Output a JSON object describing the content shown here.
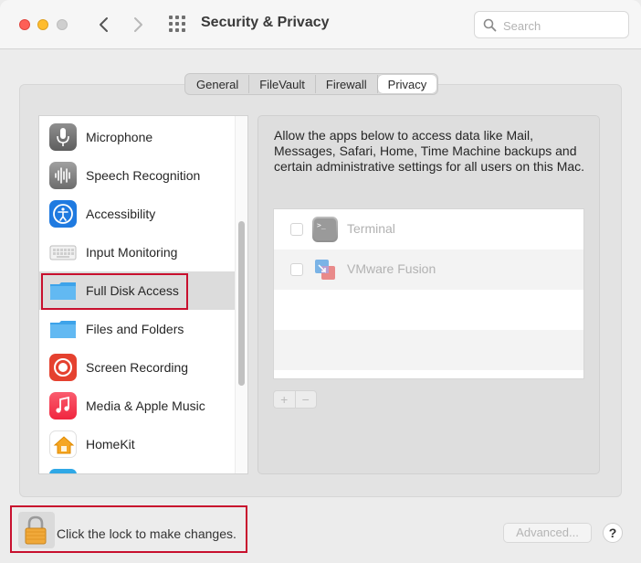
{
  "window": {
    "title": "Security & Privacy"
  },
  "search": {
    "placeholder": "Search",
    "value": ""
  },
  "tabs": [
    {
      "label": "General",
      "active": false
    },
    {
      "label": "FileVault",
      "active": false
    },
    {
      "label": "Firewall",
      "active": false
    },
    {
      "label": "Privacy",
      "active": true
    }
  ],
  "sidebar": {
    "items": [
      {
        "label": "Microphone",
        "icon": "microphone-icon"
      },
      {
        "label": "Speech Recognition",
        "icon": "waveform-icon"
      },
      {
        "label": "Accessibility",
        "icon": "accessibility-icon"
      },
      {
        "label": "Input Monitoring",
        "icon": "keyboard-icon"
      },
      {
        "label": "Full Disk Access",
        "icon": "folder-icon",
        "selected": true
      },
      {
        "label": "Files and Folders",
        "icon": "folder-icon"
      },
      {
        "label": "Screen Recording",
        "icon": "screen-recording-icon"
      },
      {
        "label": "Media & Apple Music",
        "icon": "music-icon"
      },
      {
        "label": "HomeKit",
        "icon": "home-icon"
      }
    ]
  },
  "main": {
    "description": "Allow the apps below to access data like Mail, Messages, Safari, Home, Time Machine backups and certain administrative settings for all users on this Mac.",
    "apps": [
      {
        "name": "Terminal",
        "checked": false,
        "icon": "terminal-icon"
      },
      {
        "name": "VMware Fusion",
        "checked": false,
        "icon": "vmware-icon"
      }
    ],
    "add_label": "+",
    "remove_label": "−"
  },
  "footer": {
    "lock_text": "Click the lock to make changes.",
    "advanced_label": "Advanced...",
    "help_label": "?"
  },
  "colors": {
    "highlight": "#c8102e",
    "close": "#fe5f57",
    "minimize": "#febc2e"
  }
}
